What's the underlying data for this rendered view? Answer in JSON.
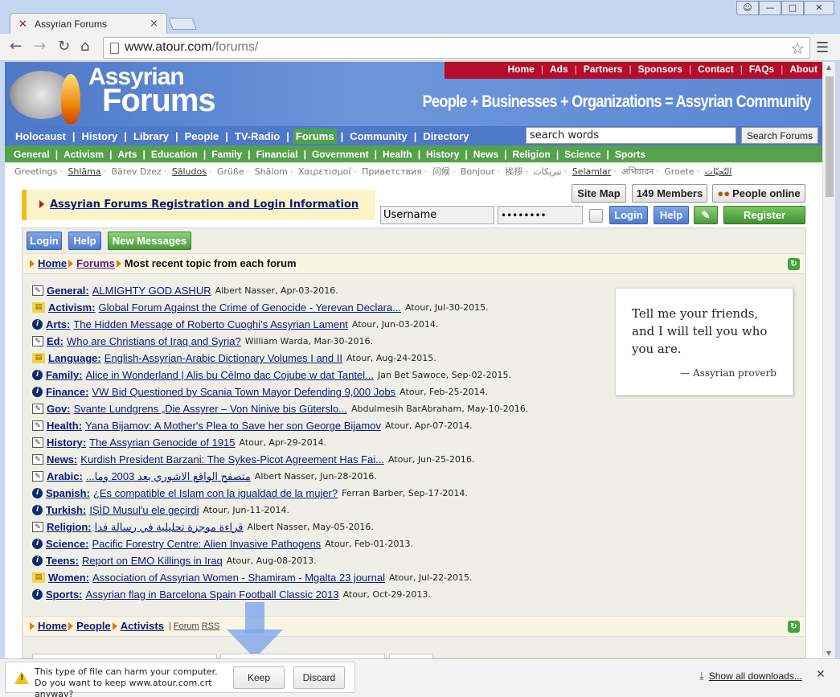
{
  "browser": {
    "tab_title": "Assyrian Forums",
    "url_host": "www.atour.com",
    "url_path": "/forums/"
  },
  "header": {
    "site_title_1": "Assyrian",
    "site_title_2": "Forums",
    "slogan": "People + Businesses + Organizations = Assyrian Community",
    "top_links": [
      "Home",
      "Ads",
      "Partners",
      "Sponsors",
      "Contact",
      "FAQs",
      "About"
    ]
  },
  "nav_main": [
    "Holocaust",
    "History",
    "Library",
    "People",
    "TV-Radio",
    "Forums",
    "Community",
    "Directory"
  ],
  "nav_main_active": "Forums",
  "search": {
    "value": "search words",
    "button": "Search Forums"
  },
  "nav_sub": [
    "General",
    "Activism",
    "Arts",
    "Education",
    "Family",
    "Financial",
    "Government",
    "Health",
    "History",
    "News",
    "Religion",
    "Science",
    "Sports"
  ],
  "greetings": [
    "Greetings",
    "Shlāma",
    "Bärev Dzez",
    "Săludos",
    "Grüße",
    "Shālom",
    "Χαιρετισμοί",
    "Приветствия",
    "问候",
    "Bonjour",
    "挨拶",
    "تبريكات",
    "Selamlar",
    "अभिवादन",
    "Groete",
    "التّحيّات"
  ],
  "reg_info": "Assyrian Forums Registration and Login Information",
  "buttons": {
    "site_map": "Site Map",
    "members": "149 Members",
    "online": "People online",
    "login": "Login",
    "help": "Help",
    "register": "Register",
    "new_messages": "New Messages"
  },
  "login": {
    "username": "Username",
    "password": "••••••••"
  },
  "breadcrumb1": {
    "home": "Home",
    "forums": "Forums",
    "current": "Most recent topic from each forum"
  },
  "forums": [
    {
      "icon": "edit",
      "name": "General:",
      "topic": "ALMIGHTY GOD ASHUR",
      "meta": "Albert Nasser, Apr-03-2016."
    },
    {
      "icon": "book",
      "name": "Activism:",
      "topic": "Global Forum Against the Crime of Genocide - Yerevan Declara...",
      "meta": "Atour, Jul-30-2015."
    },
    {
      "icon": "info",
      "name": "Arts:",
      "topic": "The Hidden Message of Roberto Cuoghi’s Assyrian Lament",
      "meta": "Atour, Jun-03-2014."
    },
    {
      "icon": "edit",
      "name": "Ed:",
      "topic": "Who are Christians of Iraq and Syria?",
      "meta": "William Warda, Mar-30-2016."
    },
    {
      "icon": "book",
      "name": "Language:",
      "topic": "English-Assyrian-Arabic Dictionary Volumes I and II",
      "meta": "Atour, Aug-24-2015."
    },
    {
      "icon": "info",
      "name": "Family:",
      "topic": "Alice in Wonderland | Alis bu Cēlmo dac Cojube w dat Tantel...",
      "meta": "Jan Bet Sawoce, Sep-02-2015."
    },
    {
      "icon": "info",
      "name": "Finance:",
      "topic": "VW Bid Questioned by Scania Town Mayor Defending 9,000 Jobs",
      "meta": "Atour, Feb-25-2014."
    },
    {
      "icon": "edit",
      "name": "Gov:",
      "topic": "Svante Lundgrens „Die Assyrer – Von Ninive bis Güterslo...",
      "meta": "Abdulmesih BarAbraham, May-10-2016."
    },
    {
      "icon": "edit",
      "name": "Health:",
      "topic": "Yana Bijamov: A Mother's Plea to Save her son George Bijamov",
      "meta": "Atour, Apr-07-2014."
    },
    {
      "icon": "edit",
      "name": "History:",
      "topic": "The Assyrian Genocide of 1915",
      "meta": "Atour, Apr-29-2014."
    },
    {
      "icon": "edit",
      "name": "News:",
      "topic": "Kurdish President Barzani: The Sykes-Picot Agreement Has Fai...",
      "meta": "Atour, Jun-25-2016."
    },
    {
      "icon": "edit",
      "name": "Arabic:",
      "topic": "متصفح الواقع الاشوري بعد 2003 وما...",
      "meta": "Albert Nasser, Jun-28-2016."
    },
    {
      "icon": "info",
      "name": "Spanish:",
      "topic": "¿Es compatible el Islam con la igualdad de la mujer?",
      "meta": "Ferran Barber, Sep-17-2014."
    },
    {
      "icon": "info",
      "name": "Turkish:",
      "topic": "IŞİD Musul'u ele geçirdi",
      "meta": "Atour, Jun-11-2014."
    },
    {
      "icon": "edit",
      "name": "Religion:",
      "topic": "قراءة موجزة تحليلية في رسالة فدا",
      "meta": "Albert Nasser, May-05-2016."
    },
    {
      "icon": "info",
      "name": "Science:",
      "topic": "Pacific Forestry Centre: Alien Invasive Pathogens",
      "meta": "Atour, Feb-01-2013."
    },
    {
      "icon": "info",
      "name": "Teens:",
      "topic": "Report on EMO Killings in Iraq",
      "meta": "Atour, Aug-08-2013."
    },
    {
      "icon": "book",
      "name": "Women:",
      "topic": "Association of Assyrian Women - Shamiram - Mgalta 23 journal",
      "meta": "Atour, Jul-22-2015."
    },
    {
      "icon": "info",
      "name": "Sports:",
      "topic": "Assyrian flag in Barcelona Spain Football Classic 2013",
      "meta": "Atour, Oct-29-2013."
    }
  ],
  "proverb": {
    "text": "Tell me your friends, and I will tell you who you are.",
    "attribution": "— Assyrian proverb"
  },
  "breadcrumb2": {
    "home": "Home",
    "people": "People",
    "activists": "Activists",
    "extra_1": "Forum",
    "extra_2": "RSS"
  },
  "download_bar": {
    "message": "This type of file can harm your computer. Do you want to keep www.atour.com.crt anyway?",
    "keep": "Keep",
    "discard": "Discard",
    "show_all": "Show all downloads..."
  }
}
